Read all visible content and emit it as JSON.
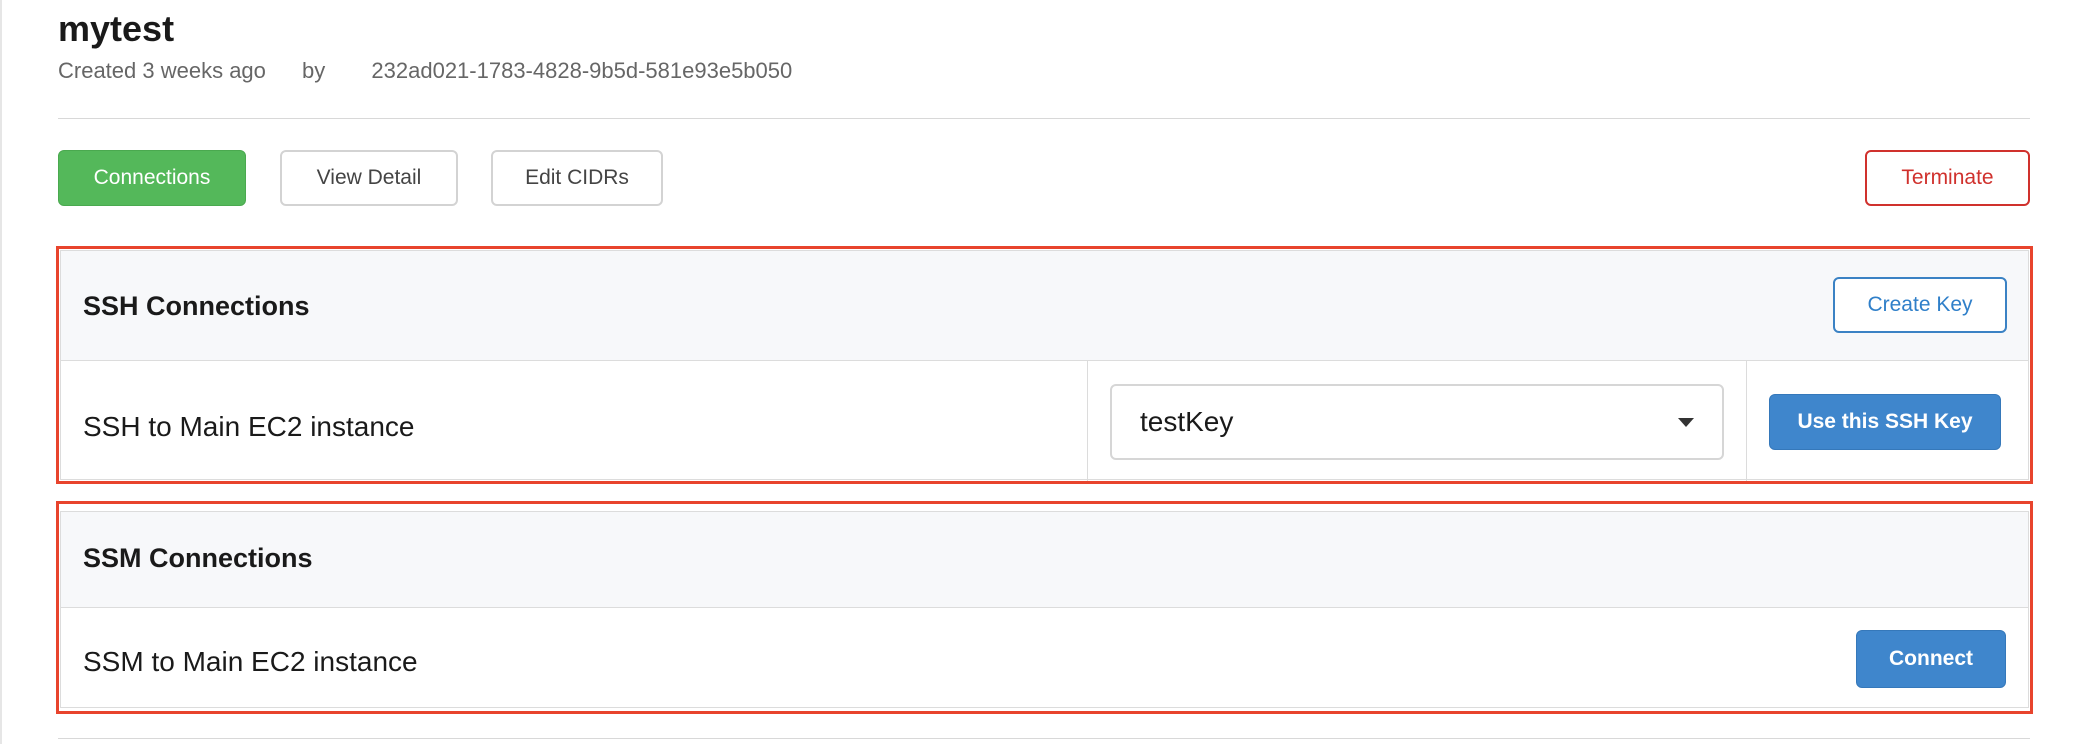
{
  "header": {
    "title": "mytest",
    "created": "Created 3 weeks ago",
    "by_label": "by",
    "creator_id": "232ad021-1783-4828-9b5d-581e93e5b050"
  },
  "tabs": {
    "connections": "Connections",
    "view_detail": "View Detail",
    "edit_cidrs": "Edit CIDRs",
    "terminate": "Terminate"
  },
  "ssh": {
    "title": "SSH Connections",
    "create_key": "Create Key",
    "row_label": "SSH to Main EC2 instance",
    "selected_key": "testKey",
    "use_key_button": "Use this SSH Key"
  },
  "ssm": {
    "title": "SSM Connections",
    "row_label": "SSM to Main EC2 instance",
    "connect_button": "Connect"
  },
  "colors": {
    "primary_green": "#54b85a",
    "danger_red": "#d0312d",
    "accent_blue": "#3f86cc",
    "highlight_red": "#e8442d"
  }
}
